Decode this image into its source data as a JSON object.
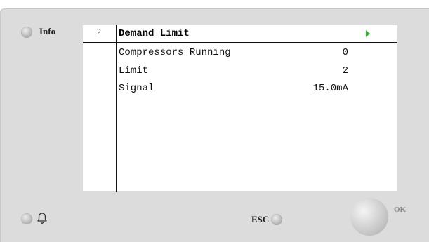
{
  "panel": {
    "info_label": "Info",
    "esc_label": "ESC",
    "ok_label": "OK"
  },
  "screen": {
    "level": "2",
    "title": "Demand Limit",
    "rows": [
      {
        "label": "Compressors Running",
        "value": "0"
      },
      {
        "label": "Limit",
        "value": "2"
      },
      {
        "label": "Signal",
        "value": "15.0mA"
      }
    ]
  },
  "icons": {
    "info_led": "info-led-icon",
    "alarm_led": "alarm-led-icon",
    "bell": "bell-icon",
    "esc_led": "esc-led-icon",
    "next_arrow": "play-arrow-icon",
    "ok_knob": "ok-knob"
  },
  "colors": {
    "arrow": "#2fb82f",
    "panel": "#dcdcdc",
    "screen": "#ffffff"
  }
}
